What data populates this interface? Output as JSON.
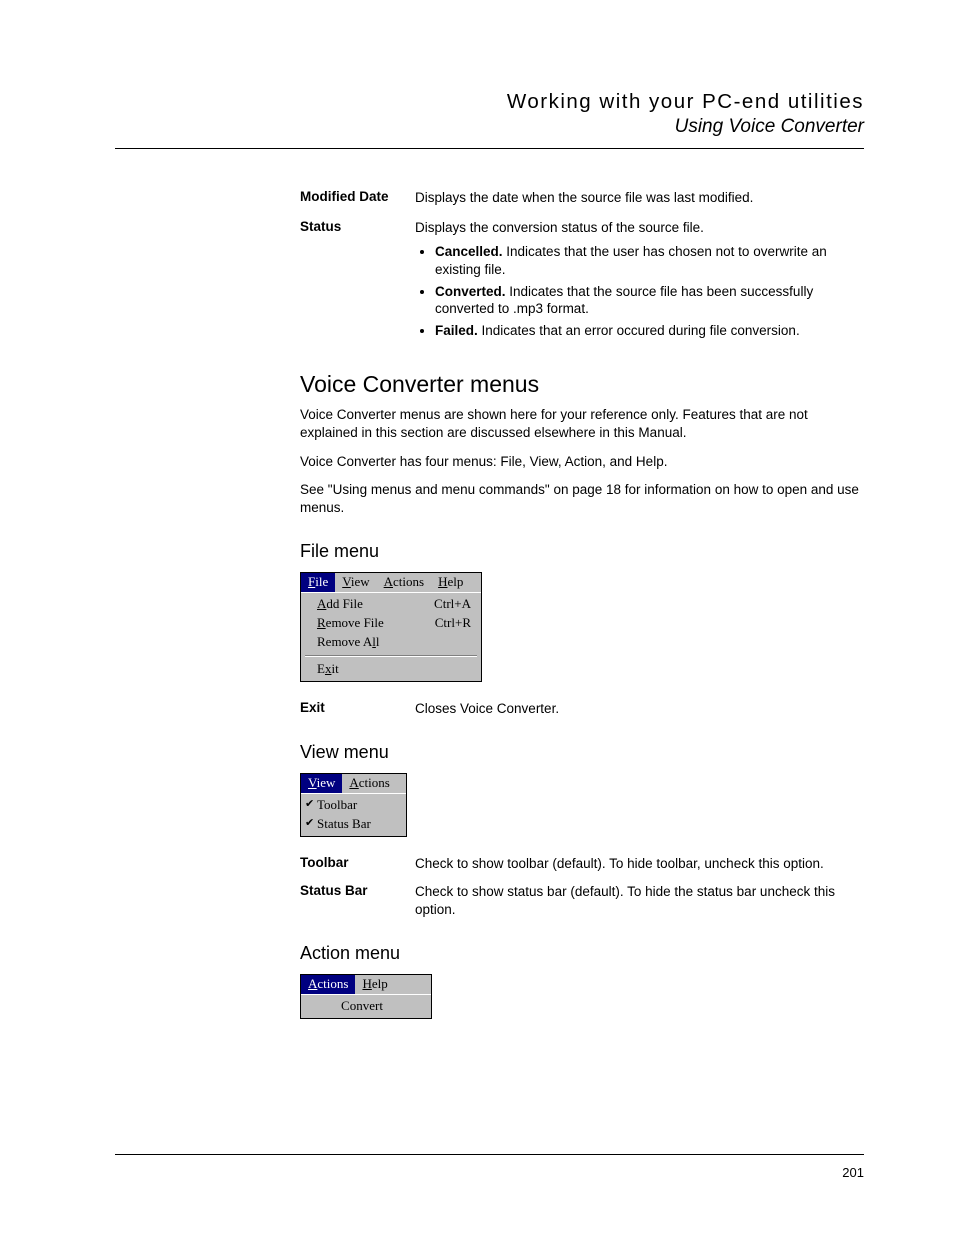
{
  "header": {
    "title": "Working with your PC-end utilities",
    "subtitle": "Using Voice Converter"
  },
  "defs": {
    "modified_date": {
      "term": "Modified Date",
      "desc": "Displays the date when the source file was last modified."
    },
    "status": {
      "term": "Status",
      "desc": "Displays the conversion status of the source file.",
      "items": {
        "cancelled": {
          "label": "Cancelled.",
          "text": " Indicates that the user has chosen not to overwrite an existing file."
        },
        "converted": {
          "label": "Converted.",
          "text": " Indicates that the source file has been successfully converted to .mp3 format."
        },
        "failed": {
          "label": "Failed.",
          "text": " Indicates that an error occured during file conversion."
        }
      }
    }
  },
  "sec": {
    "h1": "Voice Converter menus",
    "p1": "Voice Converter menus are shown here for your reference only. Features that are not explained in this section are discussed elsewhere in this Manual.",
    "p2": "Voice Converter has four menus: File, View, Action, and Help.",
    "p3": "See \"Using menus and menu commands\" on page 18 for information on how to open and use menus.",
    "file_h": "File menu",
    "view_h": "View menu",
    "action_h": "Action menu"
  },
  "file_menu": {
    "bar": {
      "file": "File",
      "view": "View",
      "actions": "Actions",
      "help": "Help"
    },
    "add": {
      "label": "Add File",
      "shortcut": "Ctrl+A"
    },
    "remove": {
      "label": "Remove File",
      "shortcut": "Ctrl+R"
    },
    "remove_all": "Remove All",
    "exit": "Exit"
  },
  "view_menu": {
    "bar": {
      "view": "View",
      "actions": "Actions"
    },
    "toolbar": "Toolbar",
    "statusbar": "Status Bar"
  },
  "action_menu": {
    "bar": {
      "actions": "Actions",
      "help": "Help"
    },
    "convert": "Convert"
  },
  "file_def": {
    "exit": {
      "term": "Exit",
      "desc": "Closes Voice Converter."
    }
  },
  "view_def": {
    "toolbar": {
      "term": "Toolbar",
      "desc": "Check to show toolbar (default). To hide toolbar, uncheck this option."
    },
    "statusbar": {
      "term": "Status Bar",
      "desc": "Check to show status bar (default). To hide the status bar uncheck this option."
    }
  },
  "page_number": "201"
}
